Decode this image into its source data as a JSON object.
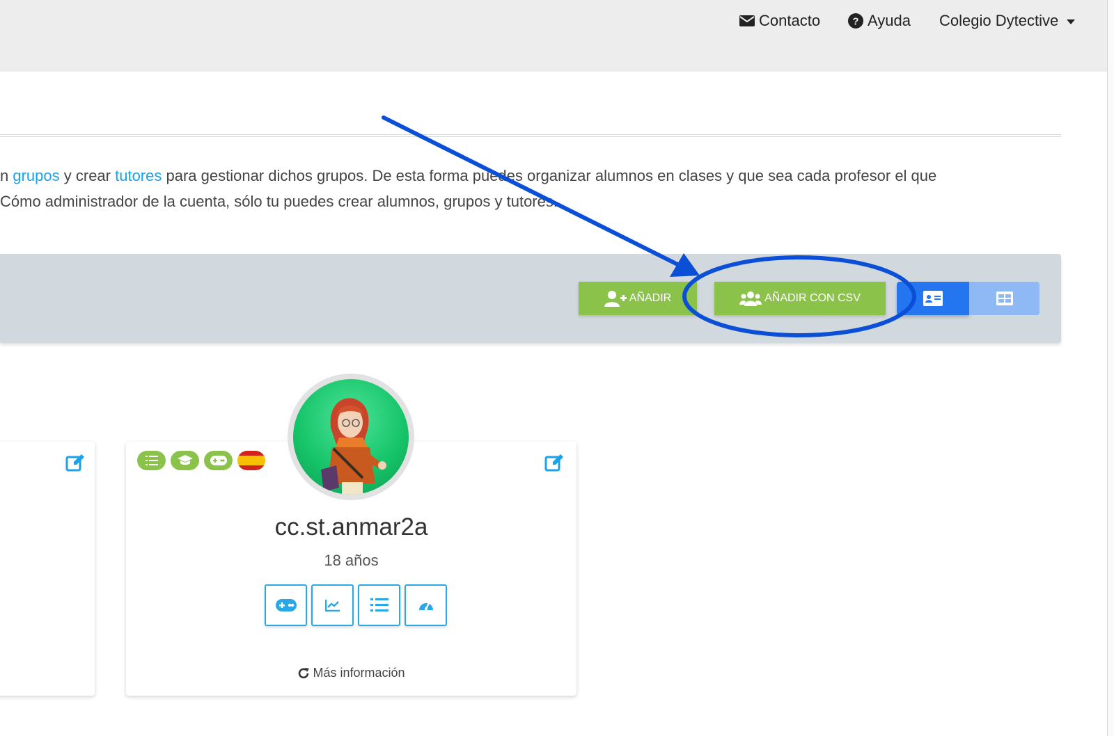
{
  "nav": {
    "contact": "Contacto",
    "help": "Ayuda",
    "user": "Colegio Dytective"
  },
  "intro": {
    "line1_pre": "n ",
    "link_groups": "grupos",
    "line1_mid": " y crear ",
    "link_tutors": "tutores",
    "line1_post": " para gestionar dichos grupos. De esta forma puedes organizar alumnos en clases y que sea cada profesor el que",
    "line2": "Cómo administrador de la cuenta, sólo tu puedes crear alumnos, grupos y tutores."
  },
  "toolbar": {
    "add_label": "AÑADIR",
    "add_csv_label": "AÑADIR CON CSV"
  },
  "student": {
    "username": "cc.st.anmar2a",
    "age": "18 años",
    "more_info": "Más información"
  },
  "colors": {
    "green": "#8bc34a",
    "blue": "#2375f0",
    "link": "#1aa3e8",
    "annotation": "#0a4fd6"
  }
}
